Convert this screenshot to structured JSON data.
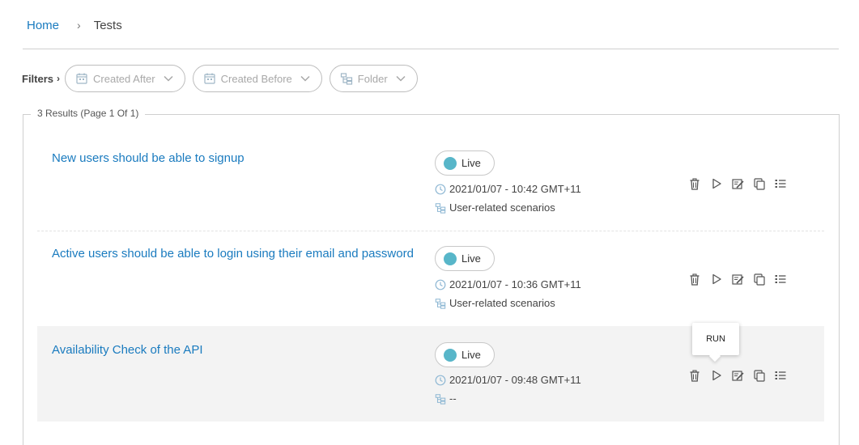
{
  "breadcrumb": {
    "home": "Home",
    "current": "Tests"
  },
  "filters": {
    "label": "Filters",
    "chips": [
      {
        "label": "Created After",
        "icon": "calendar-icon"
      },
      {
        "label": "Created Before",
        "icon": "calendar-icon"
      },
      {
        "label": "Folder",
        "icon": "folder-tree-icon"
      }
    ]
  },
  "results": {
    "summary": "3 Results (Page 1 Of 1)",
    "rows": [
      {
        "title": "New users should be able to signup",
        "status": "Live",
        "timestamp": "2021/01/07 - 10:42 GMT+11",
        "folder": "User-related scenarios"
      },
      {
        "title": "Active users should be able to login using their email and password",
        "status": "Live",
        "timestamp": "2021/01/07 - 10:36 GMT+11",
        "folder": "User-related scenarios"
      },
      {
        "title": "Availability Check of the API",
        "status": "Live",
        "timestamp": "2021/01/07 - 09:48 GMT+11",
        "folder": "--"
      }
    ]
  },
  "tooltip": {
    "text": "RUN"
  },
  "colors": {
    "link": "#1a7bbf",
    "status_live": "#58b6c9",
    "row_highlight": "#f3f3f3"
  }
}
